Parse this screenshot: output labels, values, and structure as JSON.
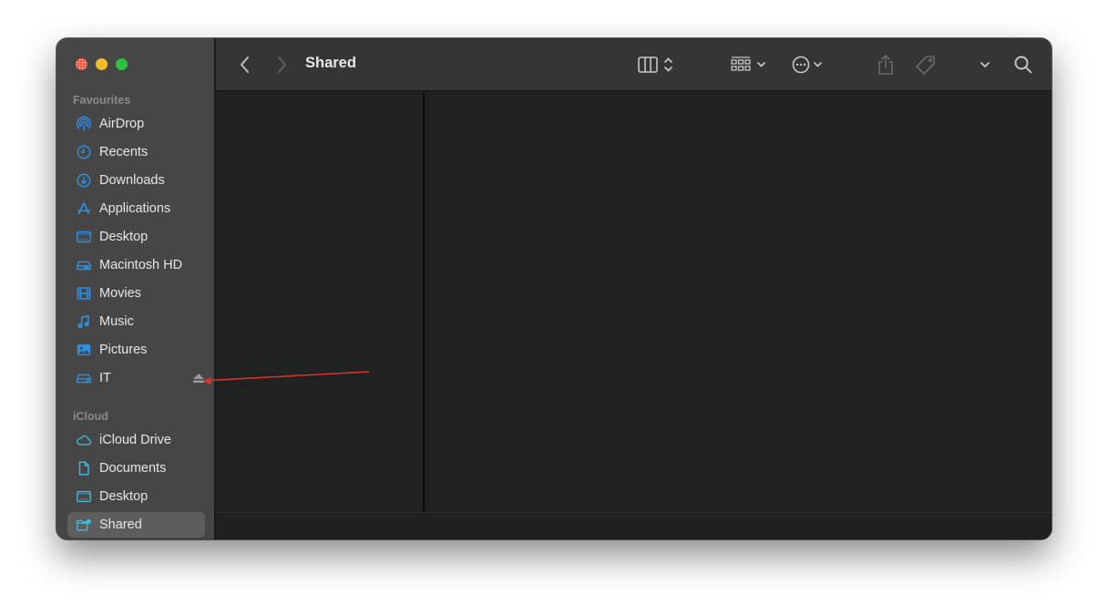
{
  "window": {
    "title": "Shared"
  },
  "toolbar": {
    "back_icon": "chevron-left",
    "forward_icon": "chevron-right",
    "view_mode_icon": "columns-view",
    "group_icon": "icon-grid",
    "action_icon": "ellipsis-circle",
    "share_icon": "share",
    "tag_icon": "tag",
    "more_icon": "chevron-down",
    "search_icon": "magnifying-glass"
  },
  "sidebar": {
    "sections": [
      {
        "title": "Favourites",
        "items": [
          {
            "label": "AirDrop",
            "icon": "airdrop"
          },
          {
            "label": "Recents",
            "icon": "clock"
          },
          {
            "label": "Downloads",
            "icon": "download-circle"
          },
          {
            "label": "Applications",
            "icon": "applications"
          },
          {
            "label": "Desktop",
            "icon": "desktop"
          },
          {
            "label": "Macintosh HD",
            "icon": "hard-drive"
          },
          {
            "label": "Movies",
            "icon": "film"
          },
          {
            "label": "Music",
            "icon": "music-note"
          },
          {
            "label": "Pictures",
            "icon": "photo"
          },
          {
            "label": "IT",
            "icon": "external-drive",
            "ejectable": true
          }
        ]
      },
      {
        "title": "iCloud",
        "items": [
          {
            "label": "iCloud Drive",
            "icon": "cloud"
          },
          {
            "label": "Documents",
            "icon": "document"
          },
          {
            "label": "Desktop",
            "icon": "desktop"
          },
          {
            "label": "Shared",
            "icon": "shared-folder",
            "selected": true
          }
        ]
      }
    ]
  },
  "colors": {
    "accent_icon": "#2f8ee0",
    "icloud_icon": "#3fb8dc",
    "annotation_arrow": "#d9342b"
  }
}
